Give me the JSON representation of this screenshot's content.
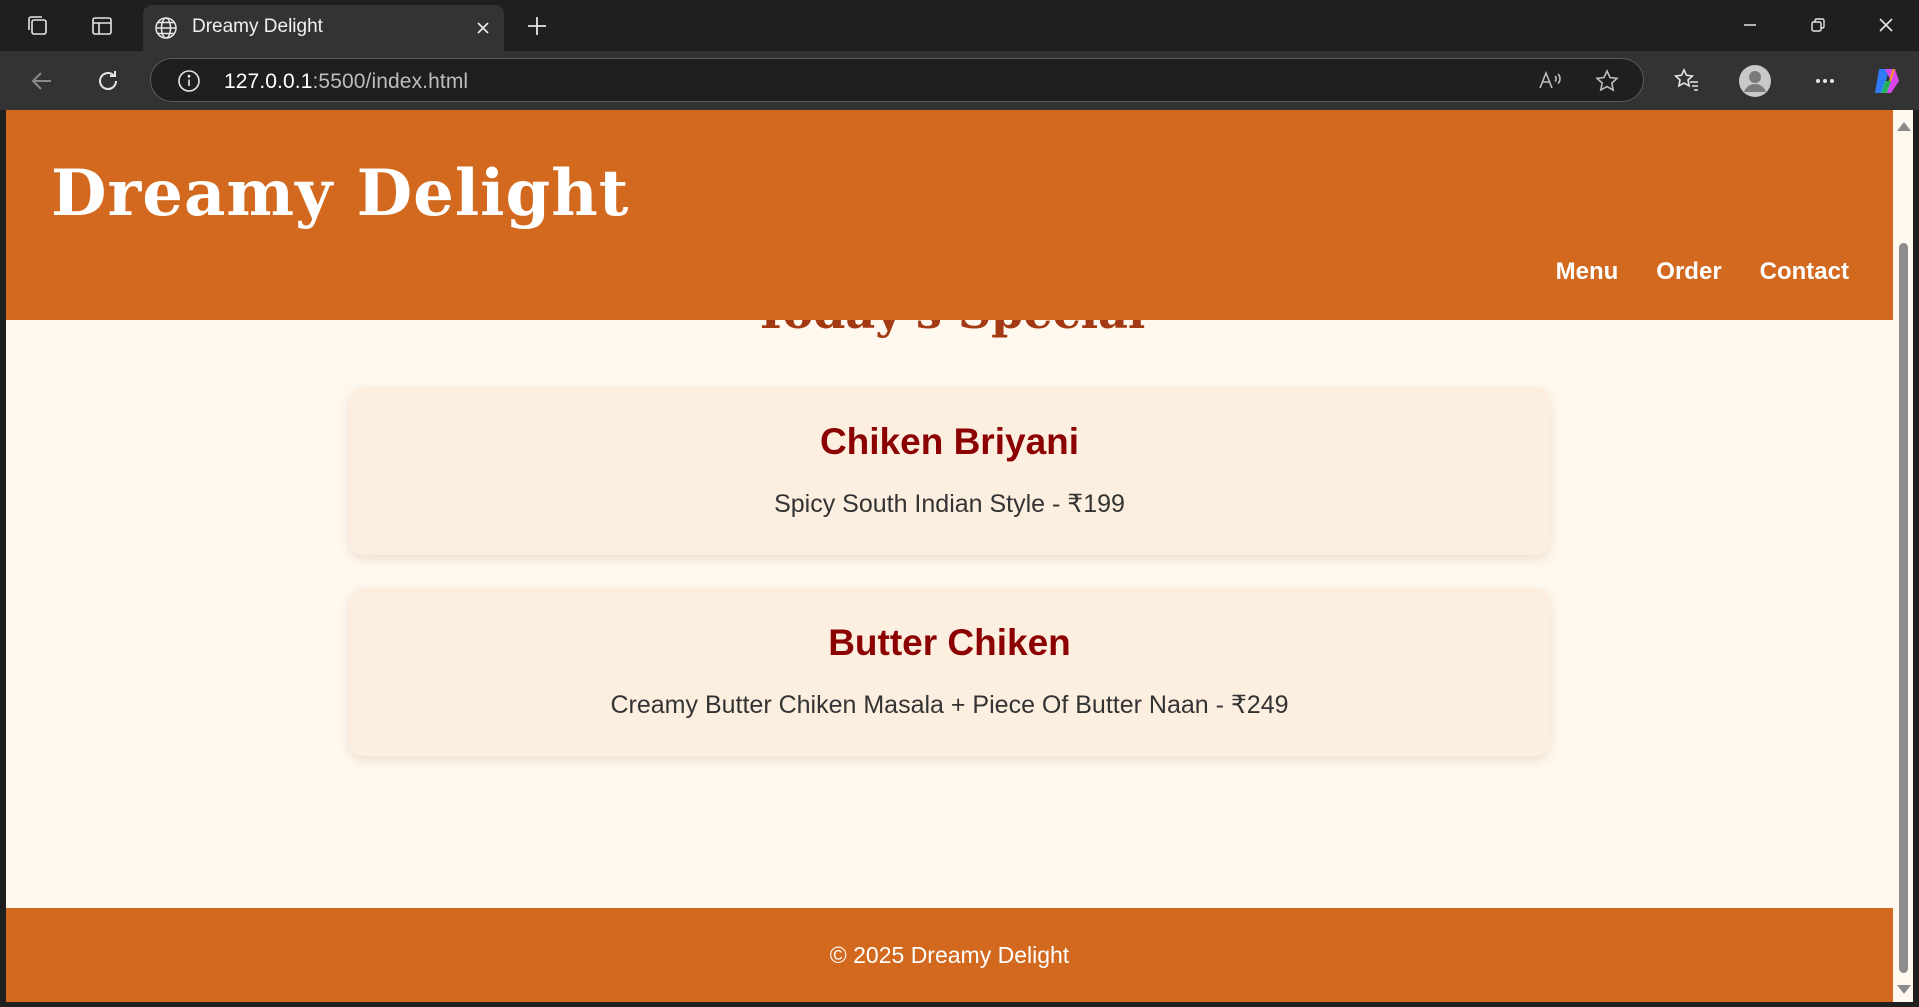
{
  "browser": {
    "tab_title": "Dreamy Delight",
    "url_host": "127.0.0.1",
    "url_rest": ":5500/index.html"
  },
  "site": {
    "title": "Dreamy Delight",
    "nav": [
      "Menu",
      "Order",
      "Contact"
    ],
    "section_heading": "Today's Special",
    "specials": [
      {
        "name": "Chiken Briyani",
        "description": "Spicy South Indian Style - ₹199"
      },
      {
        "name": "Butter Chiken",
        "description": "Creamy Butter Chiken Masala + Piece Of Butter Naan - ₹249"
      }
    ],
    "footer": "© 2025 Dreamy Delight"
  },
  "colors": {
    "brand": "#d2691e",
    "page_bg": "#fef8ee",
    "card_bg": "#fdefe0",
    "card_title": "#8b0000"
  }
}
